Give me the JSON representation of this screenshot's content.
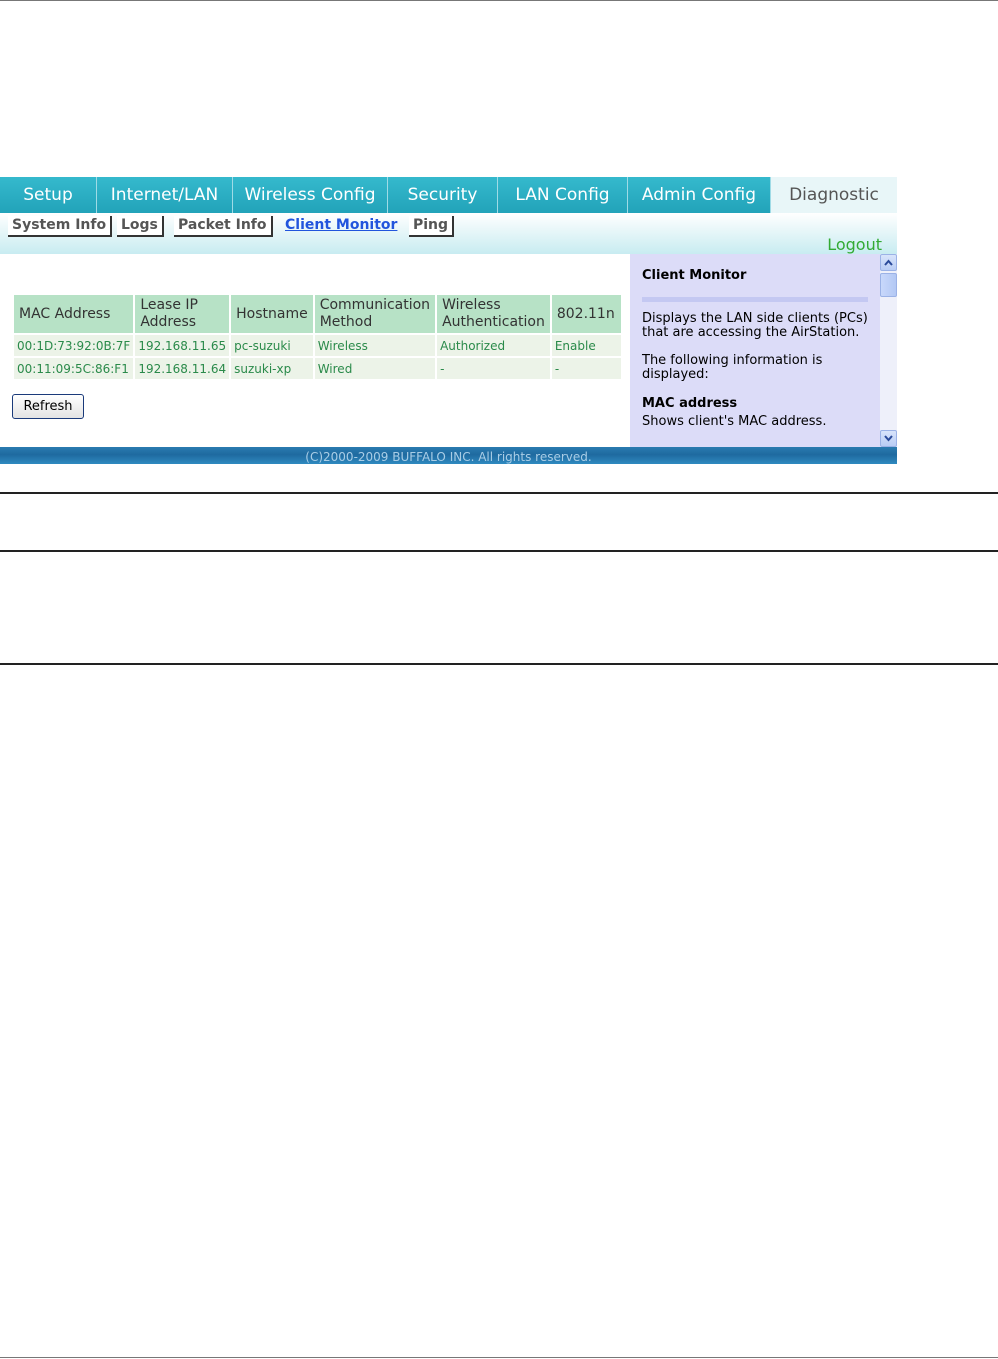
{
  "tabs": [
    {
      "label": "Setup",
      "active": false
    },
    {
      "label": "Internet/LAN",
      "active": false
    },
    {
      "label": "Wireless Config",
      "active": false
    },
    {
      "label": "Security",
      "active": false
    },
    {
      "label": "LAN Config",
      "active": false
    },
    {
      "label": "Admin Config",
      "active": false
    },
    {
      "label": "Diagnostic",
      "active": true
    }
  ],
  "subtabs": [
    {
      "label": "System Info",
      "active": false
    },
    {
      "label": "Logs",
      "active": false
    },
    {
      "label": "Packet Info",
      "active": false
    },
    {
      "label": "Client Monitor",
      "active": true
    },
    {
      "label": "Ping",
      "active": false
    }
  ],
  "logout_label": "Logout",
  "table": {
    "headers": [
      "MAC Address",
      "Lease IP Address",
      "Hostname",
      "Communication Method",
      "Wireless Authentication",
      "802.11n"
    ],
    "rows": [
      [
        "00:1D:73:92:0B:7F",
        "192.168.11.65",
        "pc-suzuki",
        "Wireless",
        "Authorized",
        "Enable"
      ],
      [
        "00:11:09:5C:86:F1",
        "192.168.11.64",
        "suzuki-xp",
        "Wired",
        "-",
        "-"
      ]
    ]
  },
  "refresh_label": "Refresh",
  "help": {
    "title": "Client Monitor",
    "paragraph1": "Displays the LAN side clients (PCs) that are accessing the AirStation.",
    "paragraph2": "The following information is displayed:",
    "subheading": "MAC address",
    "subtext": "Shows client's MAC address."
  },
  "footer": "(C)2000-2009 BUFFALO INC. All rights reserved.",
  "colors": {
    "tab_bg": "#2fb0c5",
    "active_tab_bg": "#e8f6f8",
    "header_cell": "#b7e2c6",
    "data_cell": "#ecf3e8",
    "data_text": "#2a8a4a",
    "help_bg": "#dcdcf8",
    "footer_bg": "#1f6aa0",
    "logout": "#33aa33",
    "active_link": "#2255dd"
  }
}
